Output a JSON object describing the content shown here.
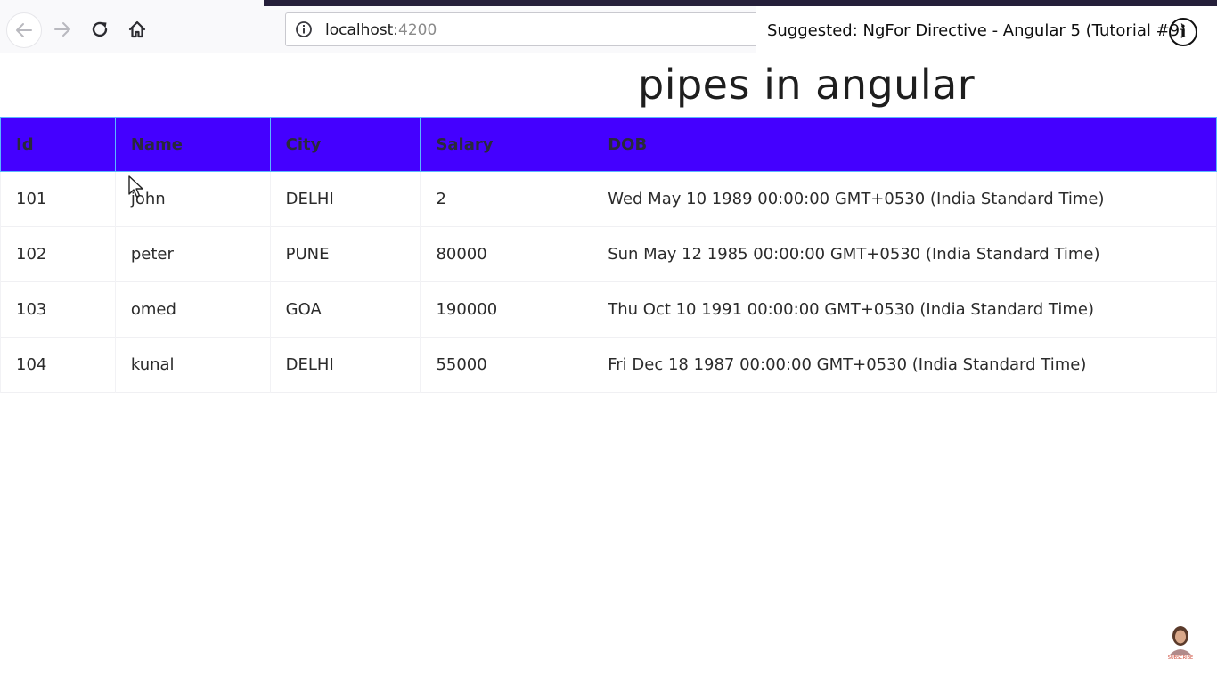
{
  "browser": {
    "url_host": "localhost:",
    "url_port": "4200",
    "colors": {
      "toolbar_bg": "#f9f9fb",
      "top_strip": "#251f3a"
    },
    "icons": [
      "back-arrow-icon",
      "forward-arrow-icon",
      "reload-icon",
      "home-icon",
      "info-icon"
    ]
  },
  "suggestion": {
    "text": "Suggested: NgFor Directive - Angular 5 (Tutorial #9)",
    "info_glyph": "i"
  },
  "page": {
    "heading": "pipes in angular"
  },
  "table": {
    "header_color": "#4400ff",
    "headers": [
      "Id",
      "Name",
      "City",
      "Salary",
      "DOB"
    ],
    "rows": [
      [
        "101",
        "john",
        "DELHI",
        "2",
        "Wed May 10 1989 00:00:00 GMT+0530 (India Standard Time)"
      ],
      [
        "102",
        "peter",
        "PUNE",
        "80000",
        "Sun May 12 1985 00:00:00 GMT+0530 (India Standard Time)"
      ],
      [
        "103",
        "omed",
        "GOA",
        "190000",
        "Thu Oct 10 1991 00:00:00 GMT+0530 (India Standard Time)"
      ],
      [
        "104",
        "kunal",
        "DELHI",
        "55000",
        "Fri Dec 18 1987 00:00:00 GMT+0530 (India Standard Time)"
      ]
    ]
  },
  "overlay": {
    "subscribe_label": "SUBSCRIBE"
  }
}
